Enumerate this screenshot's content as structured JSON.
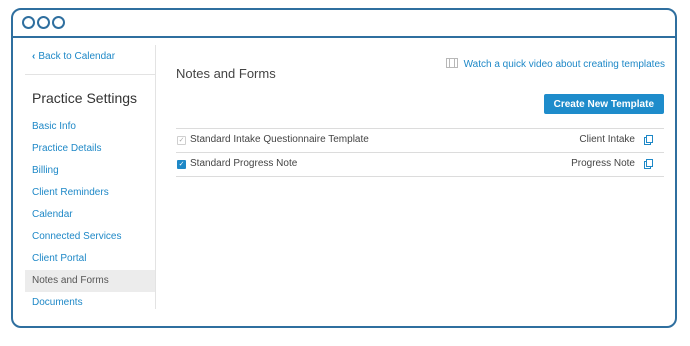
{
  "sidebar": {
    "back_label": "Back to Calendar",
    "title": "Practice Settings",
    "items": [
      {
        "label": "Basic Info"
      },
      {
        "label": "Practice Details"
      },
      {
        "label": "Billing"
      },
      {
        "label": "Client Reminders"
      },
      {
        "label": "Calendar"
      },
      {
        "label": "Connected Services"
      },
      {
        "label": "Client Portal"
      },
      {
        "label": "Notes and Forms",
        "active": true
      },
      {
        "label": "Documents"
      }
    ]
  },
  "main": {
    "title": "Notes and Forms",
    "video_link": "Watch a quick video about creating templates",
    "create_button": "Create New Template",
    "templates": [
      {
        "name": "Standard Intake Questionnaire Template",
        "type": "Client Intake",
        "checked": true,
        "disabled": true
      },
      {
        "name": "Standard Progress Note",
        "type": "Progress Note",
        "checked": true,
        "disabled": false
      }
    ]
  },
  "colors": {
    "accent": "#1e88c7",
    "frame": "#2f6f9f",
    "active_nav_bg": "#ececec"
  },
  "icons": [
    "chevron-left-icon",
    "film-icon",
    "checkbox-icon",
    "copy-icon"
  ]
}
